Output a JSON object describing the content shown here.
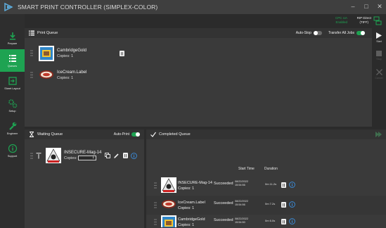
{
  "app": {
    "title": "SMART PRINT CONTROLLER (SIMPLEX-COLOR)"
  },
  "window": {
    "minimize": "–",
    "maximize": "□",
    "close": "✕"
  },
  "sidebar": {
    "items": [
      {
        "label": "Prepare",
        "icon": "download-icon",
        "active": false
      },
      {
        "label": "Queues",
        "icon": "list-icon",
        "active": true
      },
      {
        "label": "Sheet Layout",
        "icon": "sheet-layout-icon",
        "active": false
      },
      {
        "label": "Setup",
        "icon": "gears-icon",
        "active": false
      },
      {
        "label": "Engineer",
        "icon": "wrench-icon",
        "active": false
      },
      {
        "label": "Support",
        "icon": "info-icon",
        "active": false
      }
    ]
  },
  "status": {
    "cpc_line1": "CPC UA",
    "cpc_line2": "Enabled",
    "rip_line1": "RIP Direct",
    "rip_line2": "(TIFF)"
  },
  "print_queue": {
    "title": "Print Queue",
    "auto_stop_label": "Auto-Stop",
    "auto_stop_on": false,
    "transfer_label": "Transfer All Jobs",
    "transfer_on": true,
    "jobs": [
      {
        "name": "CambridgeGold",
        "copies": "Copies:  1"
      },
      {
        "name": "IceCream.Label",
        "copies": "Copies:  1"
      }
    ]
  },
  "actions": {
    "start": "Start",
    "stop": "Stop",
    "cancel": "Cancel"
  },
  "waiting_queue": {
    "title": "Waiting Queue",
    "auto_print_label": "Auto-Print",
    "auto_print_on": true,
    "jobs": [
      {
        "name": "INSECURE-Mag-14",
        "copies_label": "Copies:",
        "copies_value": "1"
      }
    ]
  },
  "completed_queue": {
    "title": "Completed Queue",
    "col_start": "Start Time",
    "col_duration": "Duration",
    "jobs": [
      {
        "name": "INSECURE-Mag-14",
        "copies": "Copies:  1",
        "status": "Succeeded",
        "date": "08/22/2022",
        "time": "15:54:56",
        "duration": "0m 11.2s"
      },
      {
        "name": "IceCream.Label",
        "copies": "Copies:  1",
        "status": "Succeeded",
        "date": "08/22/2022",
        "time": "15:54:56",
        "duration": "0m 7.2s"
      },
      {
        "name": "CambridgeGold",
        "copies": "Copies:  1",
        "status": "Succeeded",
        "date": "08/22/2022",
        "time": "15:54:50",
        "duration": "0m 6.0s"
      }
    ]
  },
  "colors": {
    "accent": "#1ea352",
    "info": "#3b8fe0",
    "background": "#2b2b2b",
    "panel": "#3a3a3a"
  }
}
